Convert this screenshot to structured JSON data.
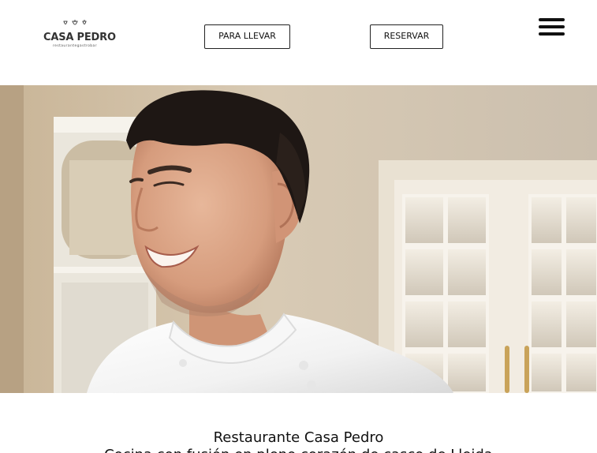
{
  "header": {
    "logo": {
      "name": "CASA PEDRO",
      "tagline": "restaurantegastrobar",
      "icon": "three-small-pots-icon"
    },
    "buttons": {
      "takeaway_label": "PARA LLEVAR",
      "reserve_label": "RESERVAR"
    },
    "menu": {
      "icon": "hamburger-menu-icon"
    }
  },
  "hero": {
    "image": "chef-portrait-photo"
  },
  "intro": {
    "title": "Restaurante Casa Pedro",
    "line": "Cocina con fusión en pleno corazón de casco de Lleida"
  }
}
